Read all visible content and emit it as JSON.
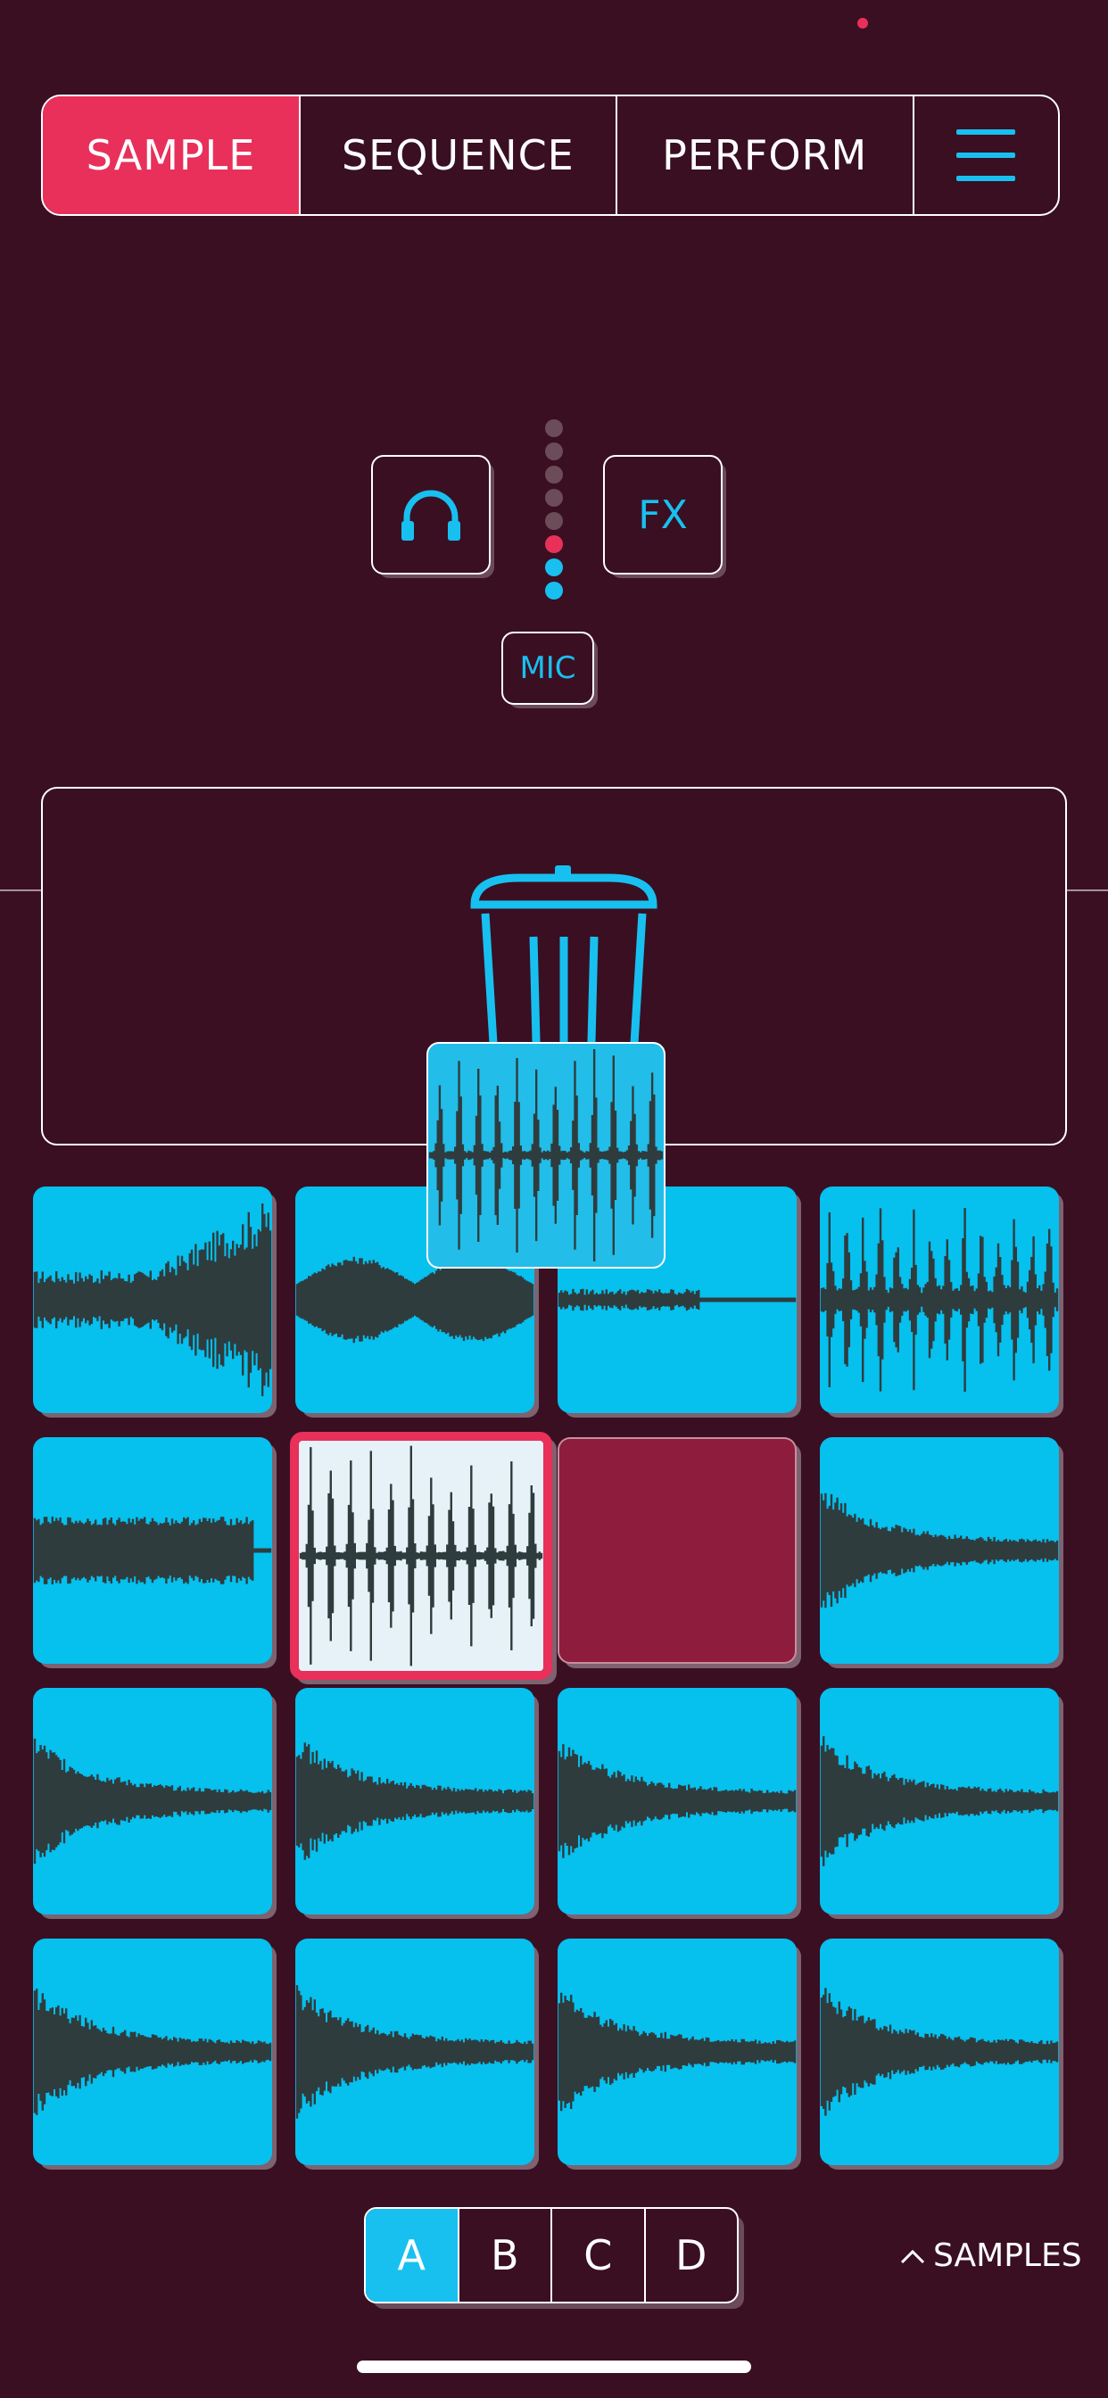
{
  "tabs": [
    {
      "label": "SAMPLE",
      "active": true
    },
    {
      "label": "SEQUENCE",
      "active": false
    },
    {
      "label": "PERFORM",
      "active": false
    }
  ],
  "menu_icon": "hamburger-menu-icon",
  "controls": {
    "monitor_icon": "headphones-icon",
    "fx_label": "FX",
    "mic_label": "MIC",
    "input_level": {
      "total_dots": 8,
      "lit_dots": 3,
      "peak_color": "#e8305a",
      "level_color": "#18c0f0",
      "off_color": "#6b4c58"
    }
  },
  "dropzone": {
    "icon": "trash-icon"
  },
  "pads": [
    {
      "state": "sample",
      "wave": "buildup"
    },
    {
      "state": "sample",
      "wave": "swell"
    },
    {
      "state": "sample",
      "wave": "thin"
    },
    {
      "state": "sample",
      "wave": "spiky"
    },
    {
      "state": "sample",
      "wave": "block"
    },
    {
      "state": "selected",
      "wave": "beat"
    },
    {
      "state": "empty",
      "wave": ""
    },
    {
      "state": "sample",
      "wave": "decay"
    },
    {
      "state": "sample",
      "wave": "decay"
    },
    {
      "state": "sample",
      "wave": "decay"
    },
    {
      "state": "sample",
      "wave": "decay"
    },
    {
      "state": "sample",
      "wave": "decay"
    },
    {
      "state": "sample",
      "wave": "decay"
    },
    {
      "state": "sample",
      "wave": "decay"
    },
    {
      "state": "sample",
      "wave": "decay"
    },
    {
      "state": "sample",
      "wave": "decay"
    }
  ],
  "banks": [
    {
      "label": "A",
      "active": true
    },
    {
      "label": "B",
      "active": false
    },
    {
      "label": "C",
      "active": false
    },
    {
      "label": "D",
      "active": false
    }
  ],
  "samples_toggle": {
    "label": "SAMPLES",
    "icon": "chevron-up-icon"
  },
  "colors": {
    "background": "#3a0f22",
    "accent_red": "#e8305a",
    "accent_cyan": "#18c0f0",
    "pad_cyan": "#06c0ee",
    "wave": "#2f3c3e"
  }
}
